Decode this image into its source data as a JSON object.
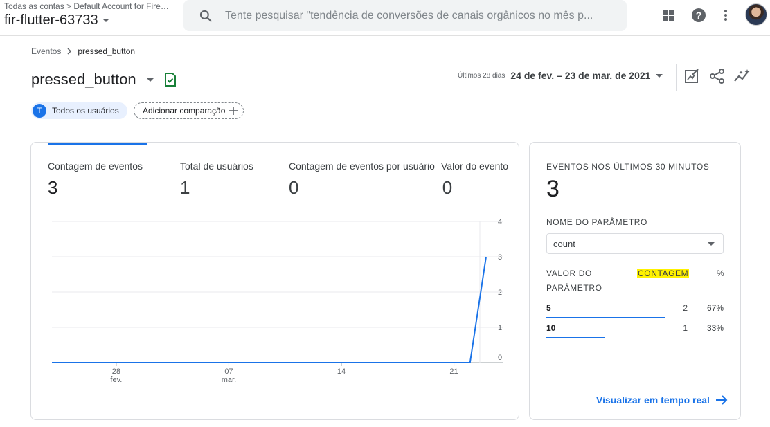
{
  "header": {
    "breadcrumb_root": "Todas as contas",
    "breadcrumb_account": "Default Account for Fire…",
    "property_name": "fir-flutter-63733",
    "search_placeholder": "Tente pesquisar \"tendência de conversões de canais orgânicos no mês p...",
    "icons": [
      "apps-grid-icon",
      "help-icon",
      "more-vert-icon"
    ]
  },
  "breadcrumb": {
    "parent": "Eventos",
    "current": "pressed_button"
  },
  "page": {
    "title": "pressed_button",
    "date_label": "Últimos 28 dias",
    "date_range": "24 de fev. – 23 de mar. de 2021",
    "actions": [
      "edit-report-icon",
      "share-icon",
      "insights-icon"
    ]
  },
  "filters": {
    "segment_initial": "T",
    "segment_label": "Todos os usuários",
    "compare_label": "Adicionar comparação"
  },
  "metrics": [
    {
      "label": "Contagem de eventos",
      "value": "3"
    },
    {
      "label": "Total de usuários",
      "value": "1"
    },
    {
      "label": "Contagem de eventos por usuário",
      "value": "0"
    },
    {
      "label": "Valor do evento",
      "value": "0"
    }
  ],
  "chart_data": {
    "type": "line",
    "x": [
      "24/02",
      "25/02",
      "26/02",
      "27/02",
      "28/02",
      "01/03",
      "02/03",
      "03/03",
      "04/03",
      "05/03",
      "06/03",
      "07/03",
      "08/03",
      "09/03",
      "10/03",
      "11/03",
      "12/03",
      "13/03",
      "14/03",
      "15/03",
      "16/03",
      "17/03",
      "18/03",
      "19/03",
      "20/03",
      "21/03",
      "22/03",
      "23/03"
    ],
    "series": [
      {
        "values": [
          0,
          0,
          0,
          0,
          0,
          0,
          0,
          0,
          0,
          0,
          0,
          0,
          0,
          0,
          0,
          0,
          0,
          0,
          0,
          0,
          0,
          0,
          0,
          0,
          0,
          0,
          0,
          3
        ]
      }
    ],
    "xticks": [
      {
        "line1": "28",
        "line2": "fev."
      },
      {
        "line1": "07",
        "line2": "mar."
      },
      {
        "line1": "14",
        "line2": ""
      },
      {
        "line1": "21",
        "line2": ""
      }
    ],
    "yticks": [
      "0",
      "1",
      "2",
      "3",
      "4"
    ],
    "ylim": [
      0,
      4
    ],
    "grid": true,
    "color": "#1a73e8"
  },
  "realtime": {
    "title": "EVENTOS NOS ÚLTIMOS 30 MINUTOS",
    "count": "3",
    "param_label": "NOME DO PARÂMETRO",
    "param_selected": "count",
    "col_value_line1": "VALOR DO",
    "col_value_line2": "PARÂMETRO",
    "col_count": "CONTAGEM",
    "col_pct": "%",
    "rows": [
      {
        "value": "5",
        "count": "2",
        "pct": "67%",
        "share": 0.67
      },
      {
        "value": "10",
        "count": "1",
        "pct": "33%",
        "share": 0.33
      }
    ],
    "link": "Visualizar em tempo real"
  }
}
